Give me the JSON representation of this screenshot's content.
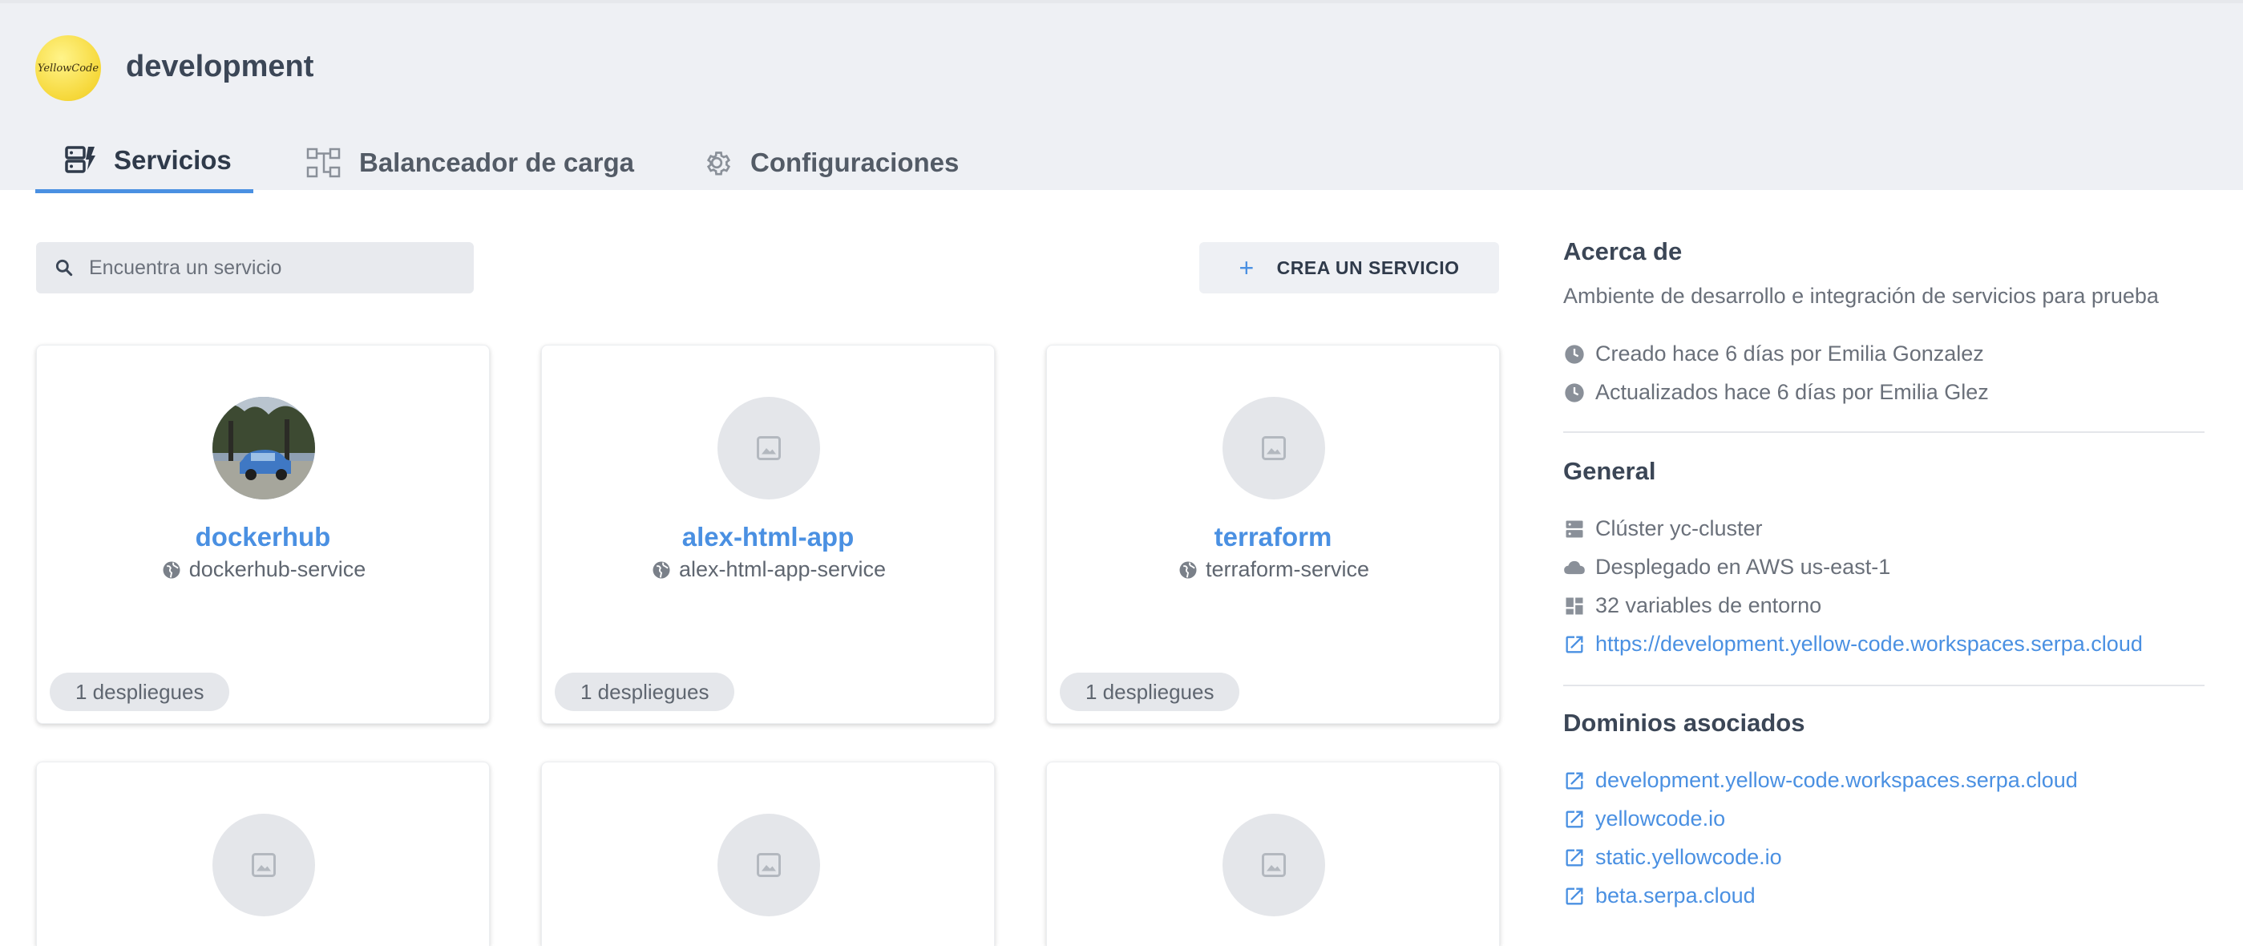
{
  "project": {
    "name": "development",
    "logo_text": "YellowCode"
  },
  "tabs": [
    {
      "label": "Servicios",
      "icon": "services-icon",
      "active": true
    },
    {
      "label": "Balanceador de carga",
      "icon": "load-balancer-icon",
      "active": false
    },
    {
      "label": "Configuraciones",
      "icon": "gear-icon",
      "active": false
    }
  ],
  "search": {
    "placeholder": "Encuentra un servicio"
  },
  "create_button": {
    "label": "CREA UN SERVICIO"
  },
  "services": [
    {
      "name": "dockerhub",
      "service": "dockerhub-service",
      "deploys": "1 despliegues",
      "has_photo": true
    },
    {
      "name": "alex-html-app",
      "service": "alex-html-app-service",
      "deploys": "1 despliegues",
      "has_photo": false
    },
    {
      "name": "terraform",
      "service": "terraform-service",
      "deploys": "1 despliegues",
      "has_photo": false
    },
    {
      "name": "",
      "service": "",
      "deploys": "",
      "has_photo": false
    },
    {
      "name": "",
      "service": "",
      "deploys": "",
      "has_photo": false
    },
    {
      "name": "",
      "service": "",
      "deploys": "",
      "has_photo": false
    }
  ],
  "about": {
    "heading": "Acerca de",
    "description": "Ambiente de desarrollo e integración de servicios para prueba",
    "created": "Creado hace 6 días por Emilia Gonzalez",
    "updated": "Actualizados hace 6 días por Emilia Glez"
  },
  "general": {
    "heading": "General",
    "cluster": "Clúster yc-cluster",
    "deployed": "Desplegado en AWS us-east-1",
    "env_vars": "32 variables de entorno",
    "url": "https://development.yellow-code.workspaces.serpa.cloud"
  },
  "domains": {
    "heading": "Dominios asociados",
    "items": [
      "development.yellow-code.workspaces.serpa.cloud",
      "yellowcode.io",
      "static.yellowcode.io",
      "beta.serpa.cloud"
    ]
  },
  "colors": {
    "accent": "#4a90e2",
    "header_bg": "#eef0f4",
    "text": "#3b4656"
  }
}
